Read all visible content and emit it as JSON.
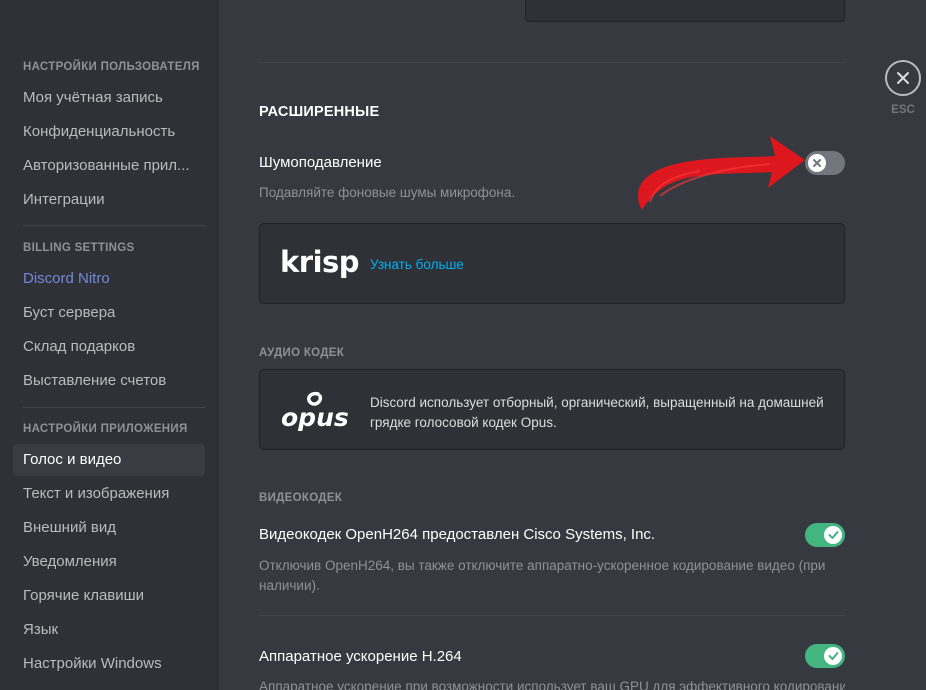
{
  "sidebar": {
    "user_settings_header": "НАСТРОЙКИ ПОЛЬЗОВАТЕЛЯ",
    "user_items": [
      "Моя учётная запись",
      "Конфиденциальность",
      "Авторизованные прил...",
      "Интеграции"
    ],
    "billing_header": "BILLING SETTINGS",
    "billing_items": [
      "Discord Nitro",
      "Буст сервера",
      "Склад подарков",
      "Выставление счетов"
    ],
    "app_settings_header": "НАСТРОЙКИ ПРИЛОЖЕНИЯ",
    "app_items": [
      "Голос и видео",
      "Текст и изображения",
      "Внешний вид",
      "Уведомления",
      "Горячие клавиши",
      "Язык",
      "Настройки Windows"
    ],
    "active_item": "Голос и видео",
    "accent_color": "#7289da"
  },
  "main": {
    "advanced_title": "РАСШИРЕННЫЕ",
    "noise_suppression": {
      "title": "Шумоподавление",
      "description": "Подавляйте фоновые шумы микрофона.",
      "enabled": false
    },
    "krisp": {
      "logo_text": "krisp",
      "learn_more": "Узнать больше"
    },
    "audio_codec": {
      "header": "АУДИО КОДЕК",
      "logo_text": "opus",
      "description": "Discord использует отборный, органический, выращенный на домашней грядке голосовой кодек Opus."
    },
    "video_codec": {
      "header": "ВИДЕОКОДЕК",
      "openh264": {
        "title": "Видеокодек OpenH264 предоставлен Cisco Systems, Inc.",
        "description": "Отключив OpenH264, вы также отключите аппаратно-ускоренное кодирование видео (при наличии).",
        "enabled": true
      },
      "hw_accel": {
        "title": "Аппаратное ускорение H.264",
        "description": "Аппаратное ускорение при возможности использует ваш GPU для эффективного кодирования",
        "enabled": true
      }
    }
  },
  "close": {
    "icon": "close-icon",
    "label": "ESC"
  },
  "colors": {
    "toggle_on": "#43b581",
    "toggle_off": "#72767d",
    "link": "#00b0f4",
    "annotation_arrow": "#e8141b"
  }
}
